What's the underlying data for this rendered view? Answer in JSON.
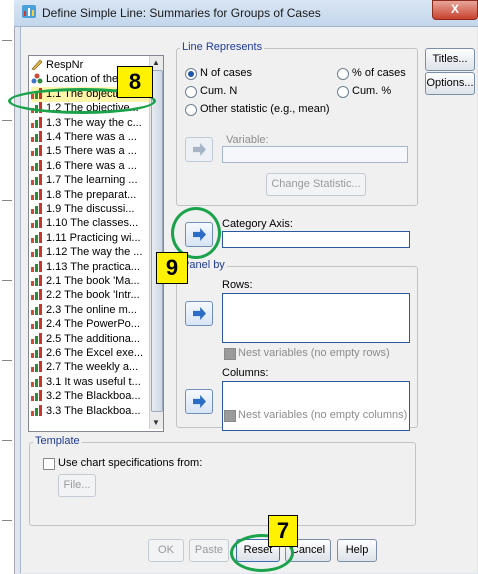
{
  "window": {
    "title": "Define Simple Line: Summaries for Groups of Cases",
    "close_label": "X"
  },
  "variables": [
    {
      "label": "RespNr",
      "type": "scale"
    },
    {
      "label": "Location of the ...",
      "type": "nominal"
    },
    {
      "label": "1.1 The objective...",
      "type": "ordinal",
      "selected": true
    },
    {
      "label": "1.2 The objective...",
      "type": "ordinal"
    },
    {
      "label": "1.3 The way the c...",
      "type": "ordinal"
    },
    {
      "label": "1.4 There was a ...",
      "type": "ordinal"
    },
    {
      "label": "1.5 There was a ...",
      "type": "ordinal"
    },
    {
      "label": "1.6 There was a ...",
      "type": "ordinal"
    },
    {
      "label": "1.7 The learning ...",
      "type": "ordinal"
    },
    {
      "label": "1.8 The preparat...",
      "type": "ordinal"
    },
    {
      "label": "1.9 The discussi...",
      "type": "ordinal"
    },
    {
      "label": "1.10 The classes...",
      "type": "ordinal"
    },
    {
      "label": "1.11 Practicing wi...",
      "type": "ordinal"
    },
    {
      "label": "1.12 The way the ...",
      "type": "ordinal"
    },
    {
      "label": "1.13 The practica...",
      "type": "ordinal"
    },
    {
      "label": "2.1 The book 'Ma...",
      "type": "ordinal"
    },
    {
      "label": "2.2 The book 'Intr...",
      "type": "ordinal"
    },
    {
      "label": "2.3 The online m...",
      "type": "ordinal"
    },
    {
      "label": "2.4 The PowerPo...",
      "type": "ordinal"
    },
    {
      "label": "2.5 The additiona...",
      "type": "ordinal"
    },
    {
      "label": "2.6 The Excel exe...",
      "type": "ordinal"
    },
    {
      "label": "2.7 The weekly a...",
      "type": "ordinal"
    },
    {
      "label": "3.1 It was useful t...",
      "type": "ordinal"
    },
    {
      "label": "3.2 The Blackboa...",
      "type": "ordinal"
    },
    {
      "label": "3.3 The Blackboa...",
      "type": "ordinal"
    }
  ],
  "line_represents": {
    "group_label": "Line Represents",
    "n_of_cases": "N of cases",
    "pct_of_cases": "% of cases",
    "cum_n": "Cum. N",
    "cum_pct": "Cum. %",
    "other_statistic": "Other statistic (e.g., mean)",
    "variable_label": "Variable:",
    "change_statistic": "Change Statistic..."
  },
  "category_axis": {
    "label": "Category Axis:",
    "value": ""
  },
  "panel_by": {
    "group_label": "Panel by",
    "rows_label": "Rows:",
    "nest_rows": "Nest variables (no empty rows)",
    "columns_label": "Columns:",
    "nest_columns": "Nest variables (no empty columns)"
  },
  "template": {
    "group_label": "Template",
    "use_spec": "Use chart specifications from:",
    "file_button": "File..."
  },
  "side_buttons": {
    "titles": "Titles...",
    "options": "Options..."
  },
  "bottom_buttons": {
    "ok": "OK",
    "paste": "Paste",
    "reset": "Reset",
    "cancel": "Cancel",
    "help": "Help"
  },
  "annotations": {
    "badge_8": "8",
    "badge_9": "9",
    "badge_7": "7"
  },
  "colors": {
    "highlight_ring": "#1aa34a",
    "badge_fill": "#fff200",
    "arrow_blue": "#2b6cc4"
  }
}
